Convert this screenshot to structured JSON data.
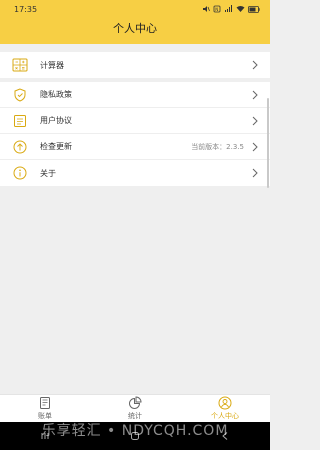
{
  "status_bar": {
    "time": "17:35"
  },
  "header": {
    "title": "个人中心"
  },
  "menu": {
    "calculator": {
      "label": "计算器",
      "icon": "calculator-icon"
    },
    "privacy": {
      "label": "隐私政策",
      "icon": "shield-icon"
    },
    "agreement": {
      "label": "用户协议",
      "icon": "document-icon"
    },
    "update": {
      "label": "检查更新",
      "icon": "upload-arrow-icon",
      "version": "当前版本：2.3.5"
    },
    "about": {
      "label": "关于",
      "icon": "info-icon"
    }
  },
  "tabs": [
    {
      "label": "账单",
      "icon": "bill-icon",
      "active": false
    },
    {
      "label": "统计",
      "icon": "pie-chart-icon",
      "active": false
    },
    {
      "label": "个人中心",
      "icon": "user-icon",
      "active": true
    }
  ],
  "watermark": "乐享轻汇 • NDYCQH.COM",
  "colors": {
    "brand": "#f7cf44",
    "icon": "#d9a911",
    "active_tab": "#d9a911"
  }
}
